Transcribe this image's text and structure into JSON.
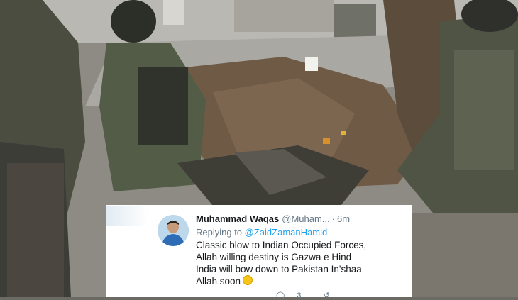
{
  "tweet": {
    "display_name": "Muhammad Waqas",
    "handle": "@Muham...",
    "separator": "·",
    "time": "6m",
    "reply_prefix": "Replying to",
    "reply_handle": "@ZaidZamanHamid",
    "lines": [
      "Classic blow to Indian Occupied Forces,",
      "Allah willing destiny is Gazwa e Hind",
      "India will bow down to Pakistan In'shaa",
      "Allah soon"
    ],
    "emoji": "slightly-smiling-face",
    "reply_count": "3"
  },
  "icons": {
    "avatar": "profile-photo",
    "reply": "comment-icon",
    "retweet": "retweet-icon",
    "like": "heart-icon"
  }
}
